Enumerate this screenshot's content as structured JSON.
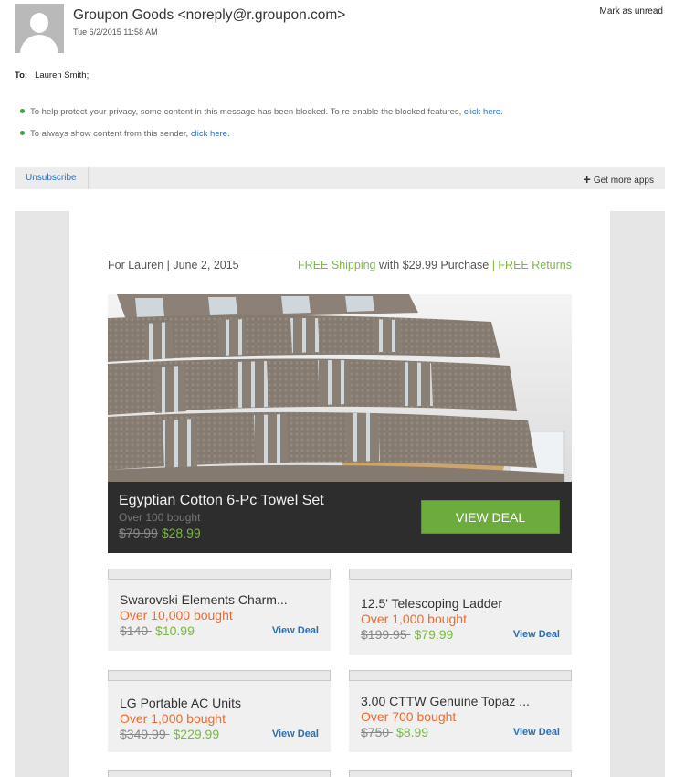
{
  "header": {
    "sender": "Groupon Goods <noreply@r.groupon.com>",
    "date": "Tue 6/2/2015 11:58 AM",
    "mark_unread": "Mark as unread",
    "to_label": "To:",
    "to_value": "Lauren Smith;"
  },
  "notices": [
    {
      "text": "To help protect your privacy, some content in this message has been blocked. To re-enable the blocked features, ",
      "link": "click here."
    },
    {
      "text": "To always show content from this sender, ",
      "link": "click here."
    }
  ],
  "toolbar": {
    "unsubscribe": "Unsubscribe",
    "get_apps": "Get more apps"
  },
  "email": {
    "for_line": "For Lauren | June 2, 2015",
    "free_shipping": "FREE Shipping",
    "shipping_mid": " with $29.99 Purchase ",
    "sep": "|",
    "free_returns": " FREE Returns",
    "featured": {
      "title": "Egyptian Cotton 6-Pc Towel Set",
      "bought": "Over 100 bought",
      "old_price": "$79.99",
      "new_price": "$28.99",
      "button": "VIEW DEAL"
    },
    "deals": [
      {
        "title": "Swarovski Elements Charm...",
        "bought": "Over 10,000 bought",
        "old_price": "$140 ",
        "new_price": "$10.99",
        "link": "View Deal"
      },
      {
        "title": "12.5' Telescoping Ladder",
        "bought": "Over 1,000 bought",
        "old_price": "$199.95 ",
        "new_price": "$79.99",
        "link": "View Deal"
      },
      {
        "title": "LG Portable AC Units",
        "bought": "Over 1,000 bought",
        "old_price": "$349.99 ",
        "new_price": "$229.99",
        "link": "View Deal"
      },
      {
        "title": "3.00 CTTW Genuine Topaz ...",
        "bought": "Over 700 bought",
        "old_price": "$750 ",
        "new_price": "$8.99",
        "link": "View Deal"
      }
    ]
  },
  "colors": {
    "accent_green": "#7ab840",
    "button_green": "#6cab3e",
    "orange": "#ef6b2f",
    "link_blue": "#2a6fb5"
  }
}
